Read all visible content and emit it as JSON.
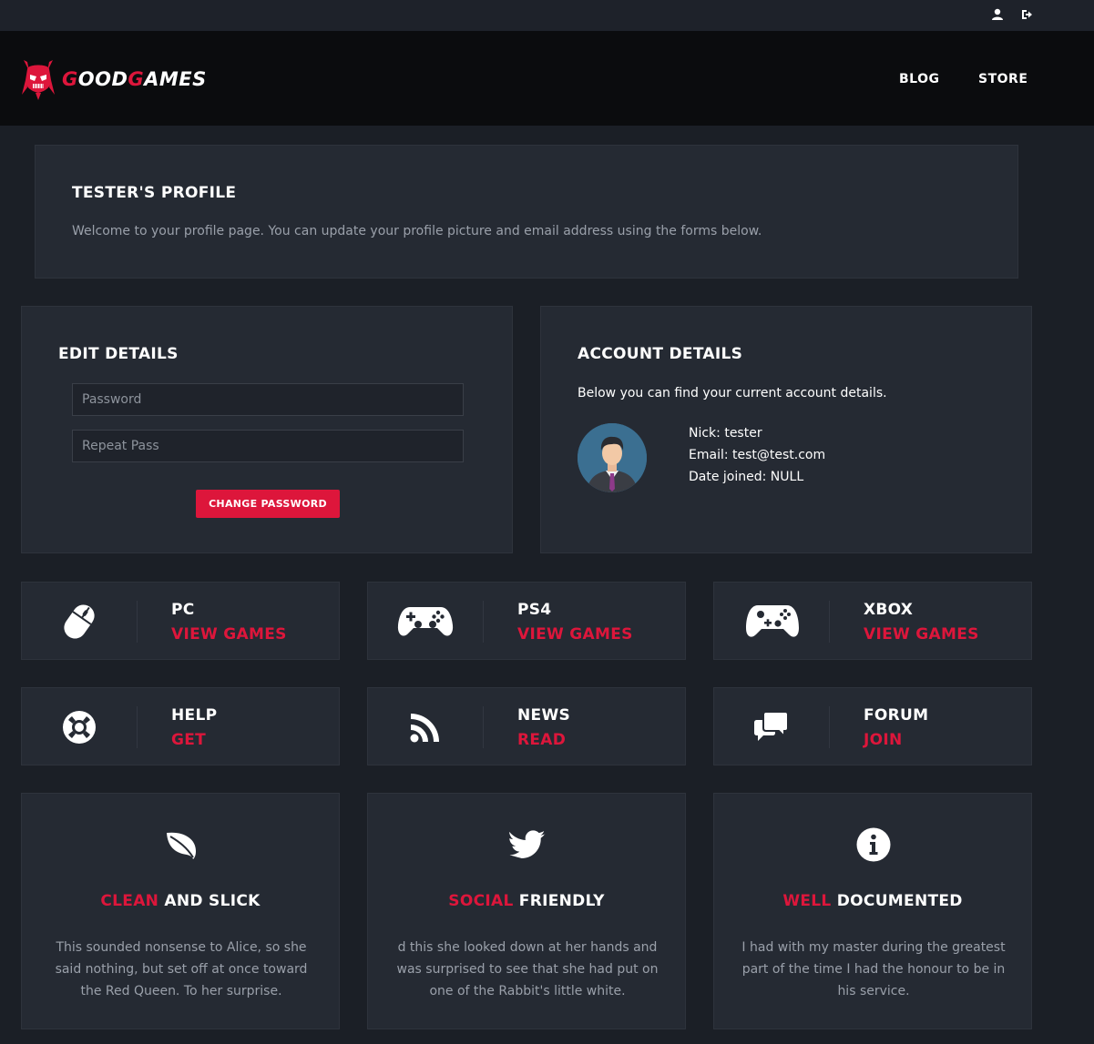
{
  "topbar": {
    "user_icon": "user-icon",
    "logout_icon": "sign-out-icon"
  },
  "brand": {
    "part1": "G",
    "part2": "OOD",
    "part3": "G",
    "part4": "AMES",
    "logo_icon": "skull-logo-icon"
  },
  "nav": {
    "blog": "BLOG",
    "store": "STORE"
  },
  "profile": {
    "title": "TESTER'S PROFILE",
    "description": "Welcome to your profile page. You can update your profile picture and email address using the forms below."
  },
  "edit": {
    "title": "EDIT DETAILS",
    "password_placeholder": "Password",
    "repeat_placeholder": "Repeat Pass",
    "button": "CHANGE PASSWORD"
  },
  "account": {
    "title": "ACCOUNT DETAILS",
    "intro": "Below you can find your current account details.",
    "nick": "Nick: tester",
    "email": "Email: test@test.com",
    "joined": "Date joined: NULL"
  },
  "categories": [
    {
      "title": "PC",
      "link": "VIEW GAMES",
      "icon": "mouse-icon"
    },
    {
      "title": "PS4",
      "link": "VIEW GAMES",
      "icon": "gamepad-icon"
    },
    {
      "title": "XBOX",
      "link": "VIEW GAMES",
      "icon": "xbox-controller-icon"
    },
    {
      "title": "HELP",
      "link": "GET",
      "icon": "life-ring-icon"
    },
    {
      "title": "NEWS",
      "link": "READ",
      "icon": "rss-icon"
    },
    {
      "title": "FORUM",
      "link": "JOIN",
      "icon": "comments-icon"
    }
  ],
  "features": [
    {
      "red": "CLEAN",
      "white": " AND SLICK",
      "icon": "leaf-icon",
      "text": "This sounded nonsense to Alice, so she said nothing, but set off at once toward the Red Queen. To her surprise."
    },
    {
      "red": "SOCIAL",
      "white": " FRIENDLY",
      "icon": "twitter-icon",
      "text": "d this she looked down at her hands and was surprised to see that she had put on one of the Rabbit's little white."
    },
    {
      "red": "WELL",
      "white": " DOCUMENTED",
      "icon": "info-icon",
      "text": "I had with my master during the greatest part of the time I had the honour to be in his service."
    }
  ],
  "colors": {
    "accent": "#dd163b",
    "panel": "#252a33",
    "background": "#1b1f26",
    "navbar": "#0b0c0e"
  }
}
